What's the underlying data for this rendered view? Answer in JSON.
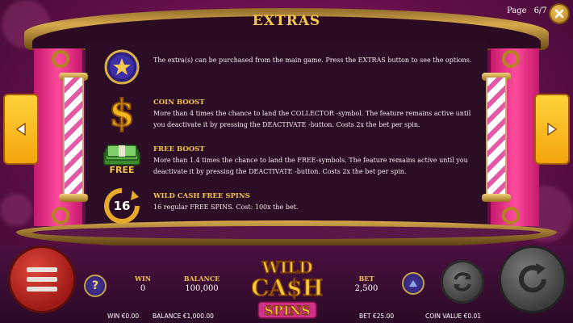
{
  "header": {
    "title": "EXTRAS",
    "page_label": "Page",
    "page_value": "6/7"
  },
  "rows": {
    "intro": {
      "text": "The extra(s) can be purchased from the main game. Press the EXTRAS button to see the options."
    },
    "coin_boost": {
      "heading": "COIN BOOST",
      "text": "More than 4 times the chance to land the COLLECTOR -symbol. The feature remains active until you deactivate it by pressing the DEACTIVATE -button. Costs 2x the bet per spin."
    },
    "free_boost": {
      "heading": "FREE BOOST",
      "icon_label": "FREE",
      "text": "More than 1.4 times the chance to land the FREE-symbols. The feature remains active until you deactivate it by pressing the DEACTIVATE -button. Costs 2x the bet per spin."
    },
    "wild_cash": {
      "heading": "WILD CASH FREE SPINS",
      "icon_number": "16",
      "text": "16 regular FREE SPINS. Cost: 100x the bet."
    }
  },
  "bottom": {
    "help_label": "?",
    "win_label": "WIN",
    "win_value": "0",
    "balance_label": "BALANCE",
    "balance_value": "100,000",
    "bet_label": "BET",
    "bet_value": "2,500",
    "win_money": "WIN €0.00",
    "balance_money": "BALANCE €1,000.00",
    "bet_money": "BET €25.00",
    "coin_value": "COIN VALUE €0.01",
    "logo_line1": "WILD",
    "logo_line2": "CA$H",
    "logo_line3": "SPINS"
  },
  "colors": {
    "accent_gold": "#f5c44a",
    "background": "#6d1050",
    "panel": "#2c0d26",
    "arrow": "#ffd23a"
  },
  "icons": [
    "close-icon",
    "arrow-left-icon",
    "arrow-right-icon",
    "star-icon",
    "dollar-icon",
    "cash-stack-icon",
    "free-spins-icon",
    "menu-icon",
    "help-icon",
    "arrow-up-icon",
    "autoplay-icon",
    "spin-icon"
  ]
}
